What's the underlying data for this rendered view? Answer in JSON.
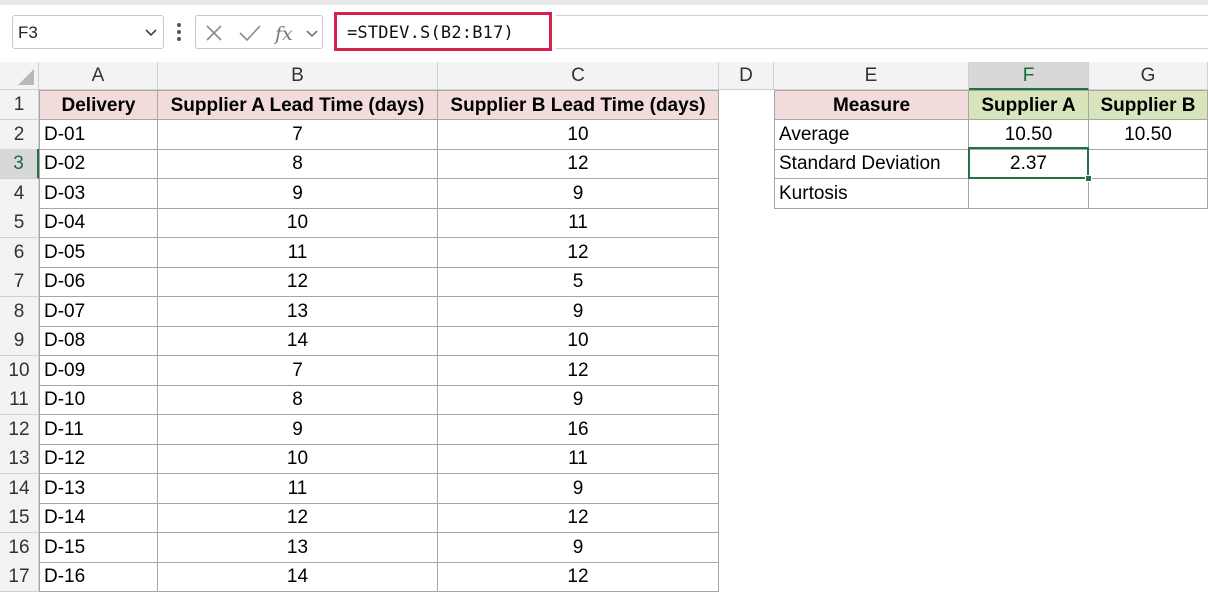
{
  "formula_bar": {
    "name_box": "F3",
    "formula": "=STDEV.S(B2:B17)",
    "icons": [
      "chevron-down-icon",
      "more-icon",
      "cancel-icon",
      "enter-icon",
      "function-icon",
      "chevron-down-icon"
    ],
    "highlight_color": "#d6204e"
  },
  "columns": [
    "A",
    "B",
    "C",
    "D",
    "E",
    "F",
    "G"
  ],
  "rows": [
    "1",
    "2",
    "3",
    "4",
    "5",
    "6",
    "7",
    "8",
    "9",
    "10",
    "11",
    "12",
    "13",
    "14",
    "15",
    "16",
    "17"
  ],
  "table1": {
    "headers": [
      "Delivery",
      "Supplier A Lead Time (days)",
      "Supplier B Lead Time (days)"
    ],
    "rows": [
      [
        "D-01",
        "7",
        "10"
      ],
      [
        "D-02",
        "8",
        "12"
      ],
      [
        "D-03",
        "9",
        "9"
      ],
      [
        "D-04",
        "10",
        "11"
      ],
      [
        "D-05",
        "11",
        "12"
      ],
      [
        "D-06",
        "12",
        "5"
      ],
      [
        "D-07",
        "13",
        "9"
      ],
      [
        "D-08",
        "14",
        "10"
      ],
      [
        "D-09",
        "7",
        "12"
      ],
      [
        "D-10",
        "8",
        "9"
      ],
      [
        "D-11",
        "9",
        "16"
      ],
      [
        "D-12",
        "10",
        "11"
      ],
      [
        "D-13",
        "11",
        "9"
      ],
      [
        "D-14",
        "12",
        "12"
      ],
      [
        "D-15",
        "13",
        "9"
      ],
      [
        "D-16",
        "14",
        "12"
      ]
    ]
  },
  "table2": {
    "headers": [
      "Measure",
      "Supplier A",
      "Supplier B"
    ],
    "rows": [
      [
        "Average",
        "10.50",
        "10.50"
      ],
      [
        "Standard Deviation",
        "2.37",
        ""
      ],
      [
        "Kurtosis",
        "",
        ""
      ]
    ]
  },
  "active_cell": "F3",
  "colors": {
    "header_pink": "#f2dcdb",
    "header_green": "#d8e4bc",
    "selection_green": "#217346"
  }
}
